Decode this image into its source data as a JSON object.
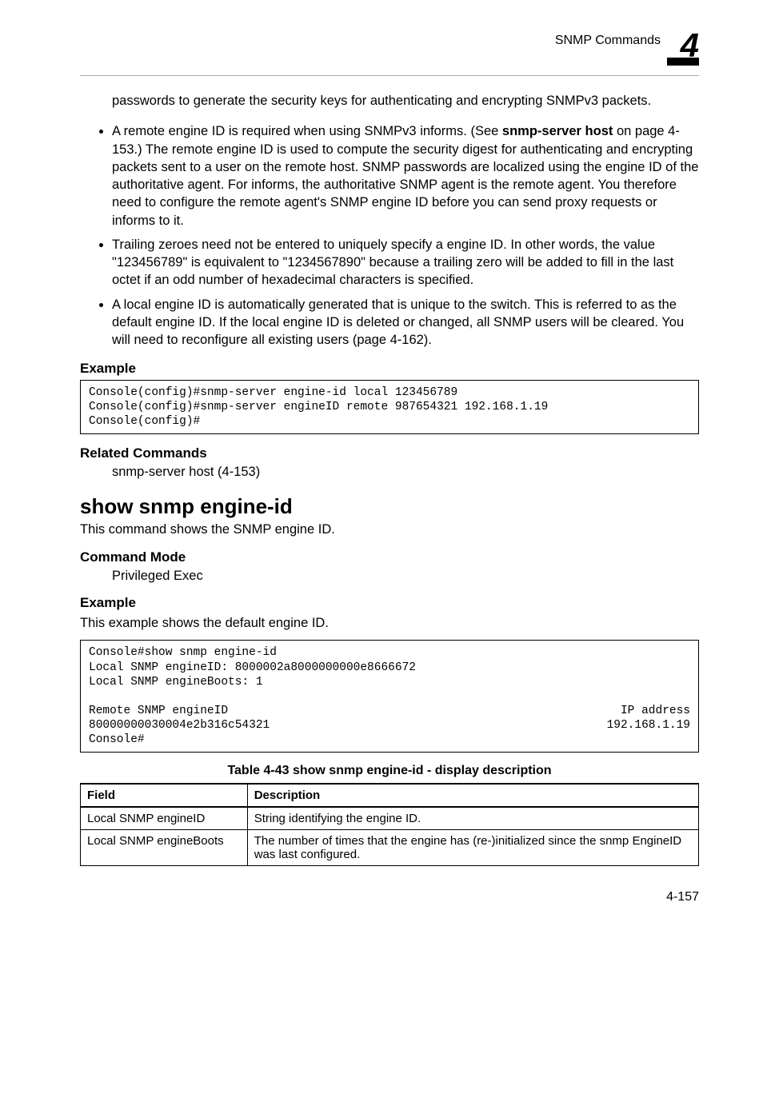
{
  "header": {
    "breadcrumb": "SNMP Commands",
    "chapter_number": "4"
  },
  "intro_continuation": "passwords to generate the security keys for authenticating and encrypting SNMPv3 packets.",
  "bullets": [
    {
      "pre": "A remote engine ID is required when using SNMPv3 informs. (See ",
      "bold": "snmp-server host",
      "post": " on page 4-153.) The remote engine ID is used to compute the security digest for authenticating and encrypting packets sent to a user on the remote host. SNMP passwords are localized using the engine ID of the authoritative agent. For informs, the authoritative SNMP agent is the remote agent. You therefore need to configure the remote agent's SNMP engine ID before you can send proxy requests or informs to it."
    },
    {
      "pre": "Trailing zeroes need not be entered to uniquely specify a engine ID. In other words, the value \"123456789\" is equivalent to \"1234567890\" because a trailing zero will be added to fill in the last octet if an odd number of hexadecimal characters is specified.",
      "bold": "",
      "post": ""
    },
    {
      "pre": "A local engine ID is automatically generated that is unique to the switch. This is referred to as the default engine ID. If the local engine ID is deleted or changed, all SNMP users will be cleared. You will need to reconfigure all existing users (page 4-162).",
      "bold": "",
      "post": ""
    }
  ],
  "labels": {
    "example": "Example",
    "related_commands": "Related Commands",
    "command_mode": "Command Mode"
  },
  "code1": "Console(config)#snmp-server engine-id local 123456789\nConsole(config)#snmp-server engineID remote 987654321 192.168.1.19\nConsole(config)#",
  "related_cmd": "snmp-server host (4-153)",
  "cmd_title": "show snmp engine-id",
  "cmd_desc": "This command shows the SNMP engine ID.",
  "command_mode_value": "Privileged Exec",
  "example2_desc": "This example shows the default engine ID.",
  "code2": {
    "block1": "Console#show snmp engine-id\nLocal SNMP engineID: 8000002a8000000000e8666672\nLocal SNMP engineBoots: 1\n",
    "line_a_left": "Remote SNMP engineID",
    "line_a_right": "IP address",
    "line_b_left": "80000000030004e2b316c54321",
    "line_b_right": "192.168.1.19",
    "block2": "Console#"
  },
  "table": {
    "caption": "Table 4-43  show snmp engine-id - display description",
    "headers": {
      "field": "Field",
      "desc": "Description"
    },
    "rows": [
      {
        "field": "Local SNMP engineID",
        "desc": "String identifying the engine ID."
      },
      {
        "field": "Local SNMP engineBoots",
        "desc": "The number of times that the engine has (re-)initialized since the snmp EngineID was last configured."
      }
    ]
  },
  "footer": "4-157"
}
